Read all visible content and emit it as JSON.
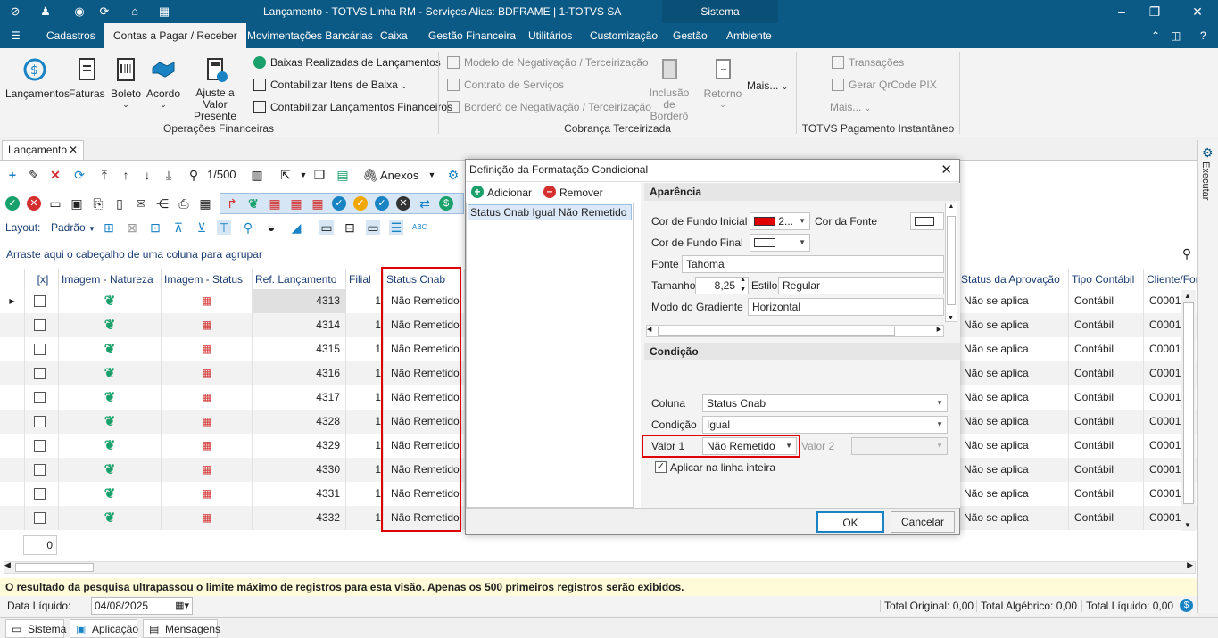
{
  "titlebar": {
    "title": "Lançamento - TOTVS Linha RM - Serviços  Alias: BDFRAME | 1-TOTVS SA",
    "sistema": "Sistema"
  },
  "menu": [
    "Cadastros",
    "Contas a Pagar / Receber",
    "Movimentações Bancárias",
    "Caixa",
    "Gestão Financeira",
    "Utilitários",
    "Customização",
    "Gestão",
    "Ambiente"
  ],
  "ribbon": {
    "big": [
      "Lançamentos",
      "Faturas",
      "Boleto",
      "Acordo",
      "Ajuste a Valor Presente"
    ],
    "small1": [
      "Baixas Realizadas de Lançamentos",
      "Contabilizar Itens de Baixa",
      "Contabilizar Lançamentos Financeiros"
    ],
    "group1": "Operações Financeiras",
    "small2": [
      "Modelo de Negativação / Terceirização",
      "Contrato de Serviços",
      "Borderô de Negativação / Terceirização"
    ],
    "inclusao": "Inclusão de Borderô",
    "retorno": "Retorno",
    "mais1": "Mais...",
    "group2": "Cobrança Terceirizada",
    "small3": [
      "Transações",
      "Gerar QrCode PIX"
    ],
    "mais2": "Mais...",
    "group3": "TOTVS Pagamento Instantâneo"
  },
  "doctab": "Lançamento",
  "toolbar": {
    "pager": "1/500",
    "anexos": "Anexos"
  },
  "layout": {
    "label": "Layout:",
    "value": "Padrão"
  },
  "groupby": "Arraste aqui o cabeçalho de uma coluna para agrupar",
  "grid": {
    "headers": [
      "[x]",
      "Imagem - Natureza",
      "Imagem - Status",
      "Ref. Lançamento",
      "Filial",
      "Status Cnab",
      "Status da Aprovação",
      "Tipo Contábil",
      "Cliente/For"
    ],
    "rows": [
      {
        "ref": "4313",
        "filial": "1",
        "cnab": "Não Remetido",
        "aprov": "Não se aplica",
        "tipo": "Contábil",
        "cli": "C0001"
      },
      {
        "ref": "4314",
        "filial": "1",
        "cnab": "Não Remetido",
        "aprov": "Não se aplica",
        "tipo": "Contábil",
        "cli": "C0001"
      },
      {
        "ref": "4315",
        "filial": "1",
        "cnab": "Não Remetido",
        "aprov": "Não se aplica",
        "tipo": "Contábil",
        "cli": "C0001"
      },
      {
        "ref": "4316",
        "filial": "1",
        "cnab": "Não Remetido",
        "aprov": "Não se aplica",
        "tipo": "Contábil",
        "cli": "C0001"
      },
      {
        "ref": "4317",
        "filial": "1",
        "cnab": "Não Remetido",
        "aprov": "Não se aplica",
        "tipo": "Contábil",
        "cli": "C0001"
      },
      {
        "ref": "4328",
        "filial": "1",
        "cnab": "Não Remetido",
        "aprov": "Não se aplica",
        "tipo": "Contábil",
        "cli": "C0001"
      },
      {
        "ref": "4329",
        "filial": "1",
        "cnab": "Não Remetido",
        "aprov": "Não se aplica",
        "tipo": "Contábil",
        "cli": "C0001"
      },
      {
        "ref": "4330",
        "filial": "1",
        "cnab": "Não Remetido",
        "aprov": "Não se aplica",
        "tipo": "Contábil",
        "cli": "C0001"
      },
      {
        "ref": "4331",
        "filial": "1",
        "cnab": "Não Remetido",
        "aprov": "Não se aplica",
        "tipo": "Contábil",
        "cli": "C0001"
      },
      {
        "ref": "4332",
        "filial": "1",
        "cnab": "Não Remetido",
        "aprov": "Não se aplica",
        "tipo": "Contábil",
        "cli": "C0001"
      }
    ],
    "count": "0"
  },
  "status_message": "O resultado da pesquisa ultrapassou o limite máximo de registros para esta visão. Apenas os 500 primeiros registros serão exibidos.",
  "footer": {
    "data_label": "Data Líquido:",
    "data_value": "04/08/2025",
    "total_original": "Total Original: 0,00",
    "total_algebrico": "Total Algébrico: 0,00",
    "total_liquido": "Total Líquido: 0,00"
  },
  "right_strip": "Executar",
  "bottom_tabs": [
    "Sistema",
    "Aplicação",
    "Mensagens"
  ],
  "dialog": {
    "title": "Definição da Formatação Condicional",
    "adicionar": "Adicionar",
    "remover": "Remover",
    "list_item": "Status Cnab Igual Não Remetido",
    "aparencia": "Aparência",
    "cor_fundo_inicial_label": "Cor de Fundo Inicial",
    "cor_fundo_inicial_value": "2...",
    "cor_fonte_label": "Cor da Fonte",
    "cor_fundo_final_label": "Cor de Fundo Final",
    "fonte_label": "Fonte",
    "fonte_value": "Tahoma",
    "tamanho_label": "Tamanho",
    "tamanho_value": "8,25",
    "estilo_label": "Estilo",
    "estilo_value": "Regular",
    "gradiente_label": "Modo do Gradiente",
    "gradiente_value": "Horizontal",
    "condicao": "Condição",
    "coluna_label": "Coluna",
    "coluna_value": "Status Cnab",
    "condicao_label": "Condição",
    "condicao_value": "Igual",
    "valor1_label": "Valor 1",
    "valor1_value": "Não Remetido",
    "valor2_label": "Valor 2",
    "aplicar": "Aplicar na linha inteira",
    "ok": "OK",
    "cancelar": "Cancelar",
    "colors": {
      "start": "#e00000",
      "highlight": "#e00000"
    }
  }
}
